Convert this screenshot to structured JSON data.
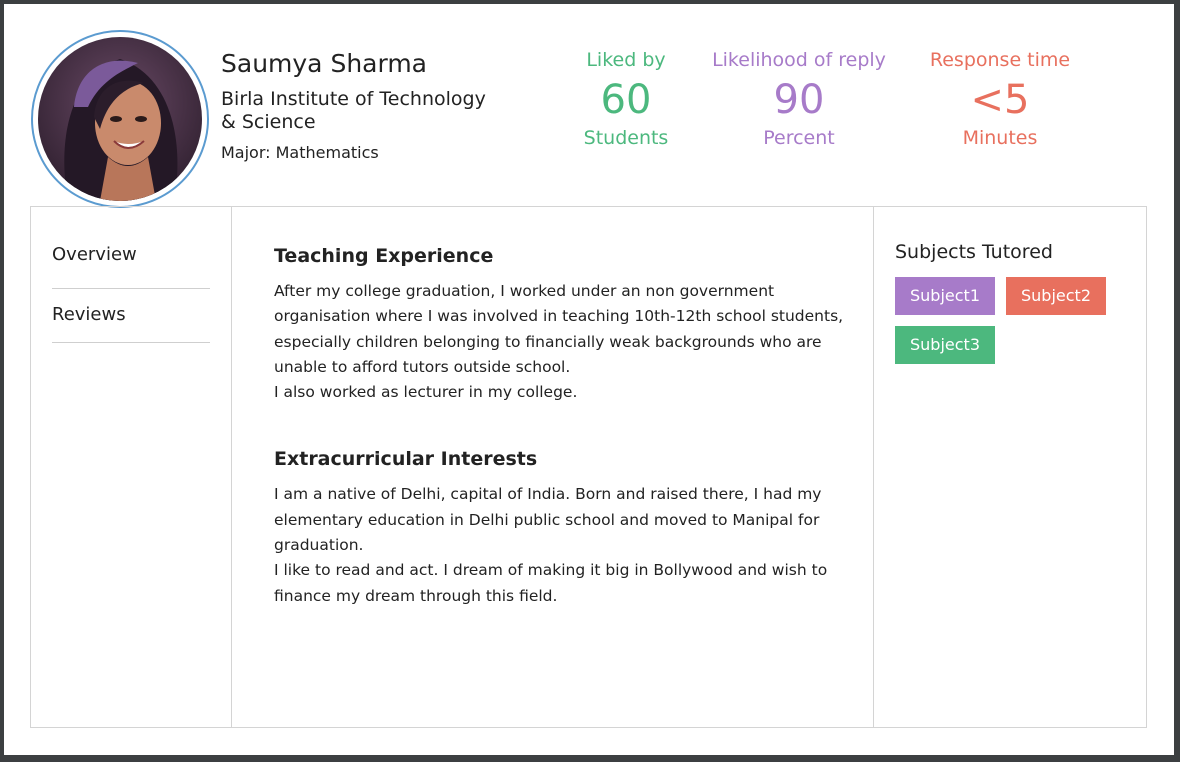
{
  "profile": {
    "name": "Saumya Sharma",
    "school": "Birla Institute of Technology & Science",
    "major": "Major: Mathematics"
  },
  "stats": {
    "liked": {
      "label": "Liked by",
      "value": "60",
      "unit": "Students",
      "color": "#4cb87e"
    },
    "reply": {
      "label": "Likelihood of reply",
      "value": "90",
      "unit": "Percent",
      "color": "#a77bc9"
    },
    "response": {
      "label": "Response time",
      "value": "<5",
      "unit": "Minutes",
      "color": "#e8705e"
    }
  },
  "nav": {
    "items": [
      {
        "label": "Overview"
      },
      {
        "label": "Reviews"
      }
    ]
  },
  "sections": [
    {
      "title": "Teaching Experience",
      "text": "After my college graduation, I worked under an non government organisation where I was involved in teaching 10th-12th school students, especially children belonging to financially weak backgrounds who are unable to afford tutors outside school.\nI also worked as lecturer in my college."
    },
    {
      "title": "Extracurricular Interests",
      "text": "I am a native of Delhi, capital of India. Born and raised there, I had my elementary education in Delhi public school and moved to Manipal for graduation.\nI like to read and act. I dream of making it big in Bollywood and wish to finance my dream through this field."
    }
  ],
  "subjects": {
    "title": "Subjects Tutored",
    "items": [
      {
        "label": "Subject1",
        "color": "#a77bc9"
      },
      {
        "label": "Subject2",
        "color": "#e8705e"
      },
      {
        "label": "Subject3",
        "color": "#4cb87e"
      }
    ]
  }
}
